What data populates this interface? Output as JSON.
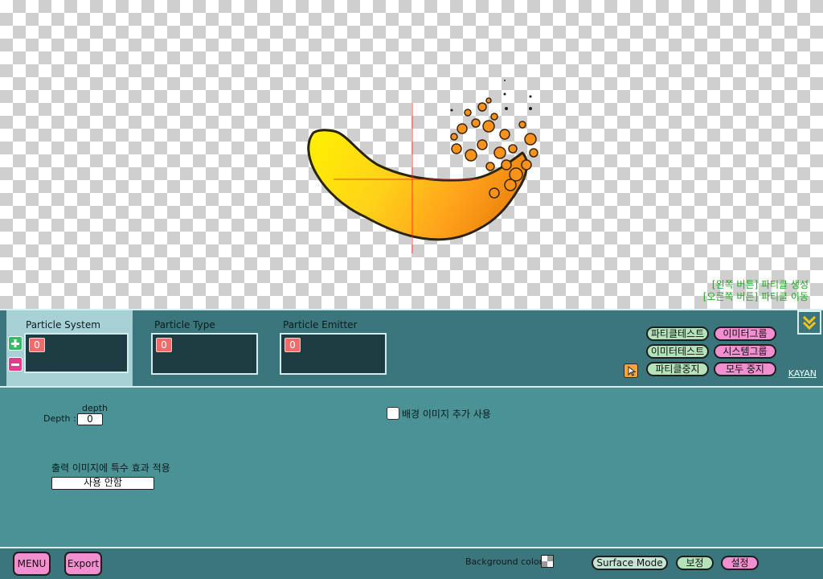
{
  "hints": {
    "left_click": "[왼쪽 버튼] 파티클 생성",
    "right_click": "[오른쪽 버튼] 파티클 이동"
  },
  "tabs": [
    {
      "label": "Particle System",
      "count": "0",
      "active": true
    },
    {
      "label": "Particle Type",
      "count": "0",
      "active": false
    },
    {
      "label": "Particle Emitter",
      "count": "0",
      "active": false
    }
  ],
  "actions": {
    "particle_test": "파티클테스트",
    "emitter_group": "이미터그룹",
    "emitter_test": "이미터테스트",
    "system_group": "시스템그룹",
    "particle_stop": "파티클중지",
    "stop_all": "모두 중지"
  },
  "kayan_link": "KAYAN",
  "settings": {
    "depth_caption": "depth",
    "depth_label": "Depth :",
    "depth_value": "0",
    "bg_image_label": "배경 이미지 추가 사용",
    "bg_image_checked": false,
    "effect_label": "출력 이미지에 특수 효과 적용",
    "effect_value": "사용 안함"
  },
  "bottom": {
    "menu": "MENU",
    "export": "Export",
    "bg_color_label": "Background color :",
    "surface_mode": "Surface Mode",
    "correction": "보정",
    "settings": "설정"
  },
  "colors": {
    "panel_dark": "#3b767d",
    "panel_light": "#4a9296",
    "tab_active": "#a8d1d6",
    "pill_green": "#b4e3ba",
    "pill_pink": "#f28fd0",
    "badge_red": "#f26b6b",
    "hint_green": "#1ea81e"
  }
}
